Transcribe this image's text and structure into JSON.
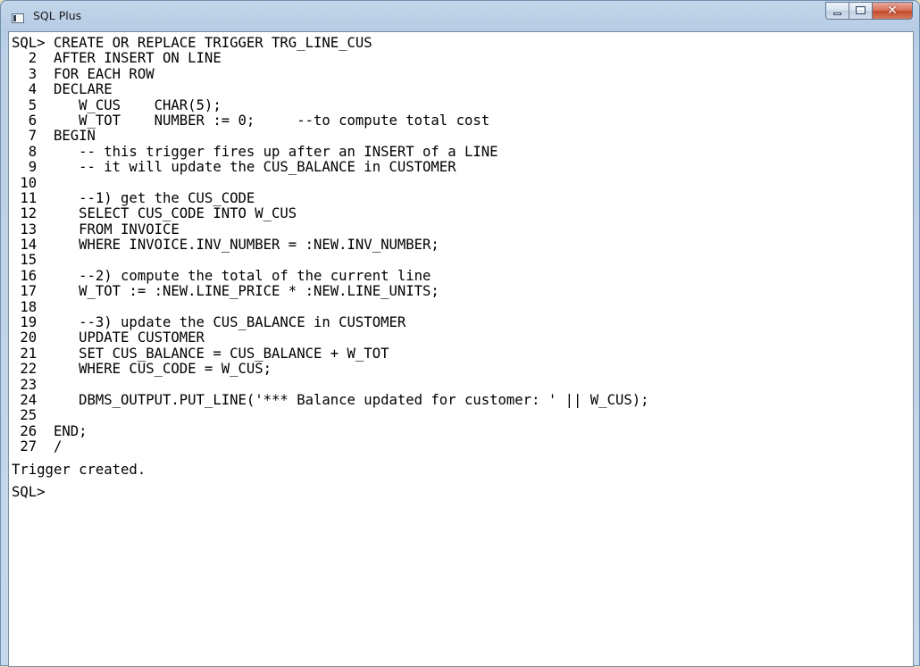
{
  "window": {
    "title": "SQL Plus"
  },
  "icons": {
    "app": "console-window-icon",
    "minimize": "minimize-icon",
    "maximize": "maximize-icon",
    "close": "close-icon"
  },
  "console": {
    "lines": [
      "SQL> CREATE OR REPLACE TRIGGER TRG_LINE_CUS",
      "  2  AFTER INSERT ON LINE",
      "  3  FOR EACH ROW",
      "  4  DECLARE",
      "  5     W_CUS    CHAR(5);",
      "  6     W_TOT    NUMBER := 0;     --to compute total cost",
      "  7  BEGIN",
      "  8     -- this trigger fires up after an INSERT of a LINE",
      "  9     -- it will update the CUS_BALANCE in CUSTOMER",
      " 10",
      " 11     --1) get the CUS_CODE",
      " 12     SELECT CUS_CODE INTO W_CUS",
      " 13     FROM INVOICE",
      " 14     WHERE INVOICE.INV_NUMBER = :NEW.INV_NUMBER;",
      " 15",
      " 16     --2) compute the total of the current line",
      " 17     W_TOT := :NEW.LINE_PRICE * :NEW.LINE_UNITS;",
      " 18",
      " 19     --3) update the CUS_BALANCE in CUSTOMER",
      " 20     UPDATE CUSTOMER",
      " 21     SET CUS_BALANCE = CUS_BALANCE + W_TOT",
      " 22     WHERE CUS_CODE = W_CUS;",
      " 23",
      " 24     DBMS_OUTPUT.PUT_LINE('*** Balance updated for customer: ' || W_CUS);",
      " 25",
      " 26  END;",
      " 27  /"
    ],
    "result": "Trigger created.",
    "prompt": "SQL>"
  }
}
